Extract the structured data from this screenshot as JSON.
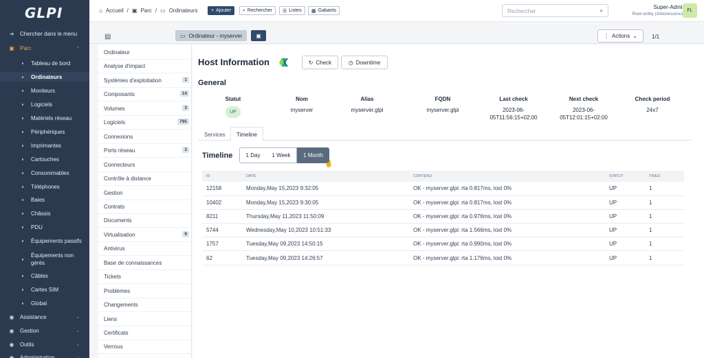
{
  "app": {
    "logo": "GLPI"
  },
  "sidebar": {
    "search": "Chercher dans le menu",
    "section": "Parc",
    "items": [
      {
        "label": "Tableau de bord",
        "icon": "dashboard-icon"
      },
      {
        "label": "Ordinateurs",
        "icon": "computer-icon"
      },
      {
        "label": "Moniteurs",
        "icon": "monitor-icon"
      },
      {
        "label": "Logiciels",
        "icon": "software-icon"
      },
      {
        "label": "Matériels réseau",
        "icon": "network-icon"
      },
      {
        "label": "Périphériques",
        "icon": "peripheral-icon"
      },
      {
        "label": "Imprimantes",
        "icon": "printer-icon"
      },
      {
        "label": "Cartouches",
        "icon": "cartridge-icon"
      },
      {
        "label": "Consommables",
        "icon": "consumable-icon"
      },
      {
        "label": "Téléphones",
        "icon": "phone-icon"
      },
      {
        "label": "Baies",
        "icon": "rack-icon"
      },
      {
        "label": "Châssis",
        "icon": "chassis-icon"
      },
      {
        "label": "PDU",
        "icon": "pdu-icon"
      },
      {
        "label": "Équipements passifs",
        "icon": "passive-icon"
      },
      {
        "label": "Équipements non",
        "label2": "gérés",
        "icon": "unmanaged-icon"
      },
      {
        "label": "Câbles",
        "icon": "cable-icon"
      },
      {
        "label": "Cartes SIM",
        "icon": "sim-icon"
      },
      {
        "label": "Global",
        "icon": "global-icon"
      }
    ],
    "sections": [
      {
        "label": "Assistance",
        "icon": "assistance-icon"
      },
      {
        "label": "Gestion",
        "icon": "management-icon"
      },
      {
        "label": "Outils",
        "icon": "tools-icon"
      },
      {
        "label": "Administration",
        "icon": "admin-icon"
      }
    ]
  },
  "topbar": {
    "breadcrumb": [
      "Accueil",
      "Parc",
      "Ordinateurs"
    ],
    "add": "Ajouter",
    "search_btn": "Rechercher",
    "lists": "Listes",
    "templates": "Gabarits",
    "search_placeholder": "Rechercher",
    "user_name": "Super-Admin",
    "user_entity": "Root entity (Arborescence)",
    "avatar": "FL"
  },
  "subheader": {
    "item_title": "Ordinateur - myserver",
    "actions": "Actions",
    "pager": "1/1"
  },
  "tabs": [
    {
      "label": "Ordinateur"
    },
    {
      "label": "Analyse d'impact"
    },
    {
      "label": "Systèmes d'exploitation",
      "badge": "1"
    },
    {
      "label": "Composants",
      "badge": "14"
    },
    {
      "label": "Volumes",
      "badge": "3"
    },
    {
      "label": "Logiciels",
      "badge": "795"
    },
    {
      "label": "Connexions"
    },
    {
      "label": "Ports réseau",
      "badge": "3"
    },
    {
      "label": "Connecteurs"
    },
    {
      "label": "Contrôle à distance"
    },
    {
      "label": "Gestion"
    },
    {
      "label": "Contrats"
    },
    {
      "label": "Documents"
    },
    {
      "label": "Virtualisation",
      "badge": "9"
    },
    {
      "label": "Antivirus"
    },
    {
      "label": "Base de connaissances"
    },
    {
      "label": "Tickets"
    },
    {
      "label": "Problèmes"
    },
    {
      "label": "Changements"
    },
    {
      "label": "Liens"
    },
    {
      "label": "Certificats"
    },
    {
      "label": "Verrous"
    }
  ],
  "host": {
    "title": "Host Information",
    "check": "Check",
    "downtime": "Downtime",
    "general": "General",
    "headers": [
      "Statut",
      "Nom",
      "Alias",
      "FQDN",
      "Last check",
      "Next check",
      "Check period"
    ],
    "values": {
      "status": "UP",
      "name": "myserver",
      "alias": "myserver.glpi",
      "fqdn": "myserver.glpi",
      "last_check_1": "2023-06-",
      "last_check_2": "05T11:56:15+02:00",
      "next_check_1": "2023-06-",
      "next_check_2": "05T12:01:15+02:00",
      "period": "24x7"
    }
  },
  "subtabs": [
    "Services",
    "Timeline"
  ],
  "timeline": {
    "title": "Timeline",
    "ranges": [
      "1 Day",
      "1 Week",
      "1 Month"
    ],
    "active_range": "1 Month",
    "columns": [
      "ID",
      "Date",
      "Contenu",
      "Statut",
      "Tries"
    ],
    "rows": [
      {
        "id": "12158",
        "date": "Monday,May 15,2023 9:32:05",
        "content": "OK - myserver.glpi: rta 0.817ms, lost 0%",
        "status": "UP",
        "tries": "1"
      },
      {
        "id": "10402",
        "date": "Monday,May 15,2023 9:30:05",
        "content": "OK - myserver.glpi: rta 0.817ms, lost 0%",
        "status": "UP",
        "tries": "1"
      },
      {
        "id": "8211",
        "date": "Thursday,May 11,2023 11:50:09",
        "content": "OK - myserver.glpi: rta 0.976ms, lost 0%",
        "status": "UP",
        "tries": "1"
      },
      {
        "id": "5744",
        "date": "Wednesday,May 10,2023 10:51:33",
        "content": "OK - myserver.glpi: rta 1.566ms, lost 0%",
        "status": "UP",
        "tries": "1"
      },
      {
        "id": "1757",
        "date": "Tuesday,May 09,2023 14:50:15",
        "content": "OK - myserver.glpi: rta 0.990ms, lost 0%",
        "status": "UP",
        "tries": "1"
      },
      {
        "id": "62",
        "date": "Tuesday,May 09,2023 14:26:57",
        "content": "OK - myserver.glpi: rta 1.176ms, lost 0%",
        "status": "UP",
        "tries": "1"
      }
    ]
  }
}
